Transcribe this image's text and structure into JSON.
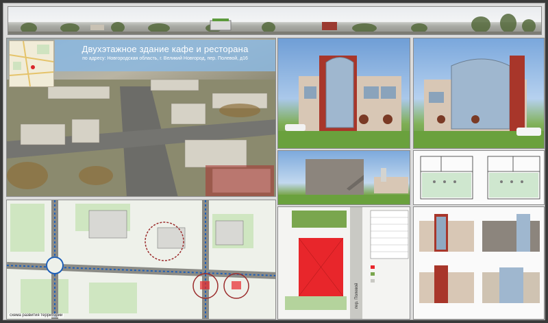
{
  "poster": {
    "title": "Двухэтажное здание кафе и ресторана",
    "subtitle": "по адресу: Новгородская область, г. Великий Новгород, пер. Полевой, д16",
    "map_caption": "схема развития территории",
    "street_label": "пер. Полевой"
  },
  "colors": {
    "board_bg": "#dcdcdc",
    "title_box": "#8cb9e1",
    "facade_red": "#a8362a",
    "facade_beige": "#d8c7b5",
    "glass": "#9fb7cf",
    "plot_red": "#e8262b",
    "route_blue": "#1e5fb8"
  }
}
